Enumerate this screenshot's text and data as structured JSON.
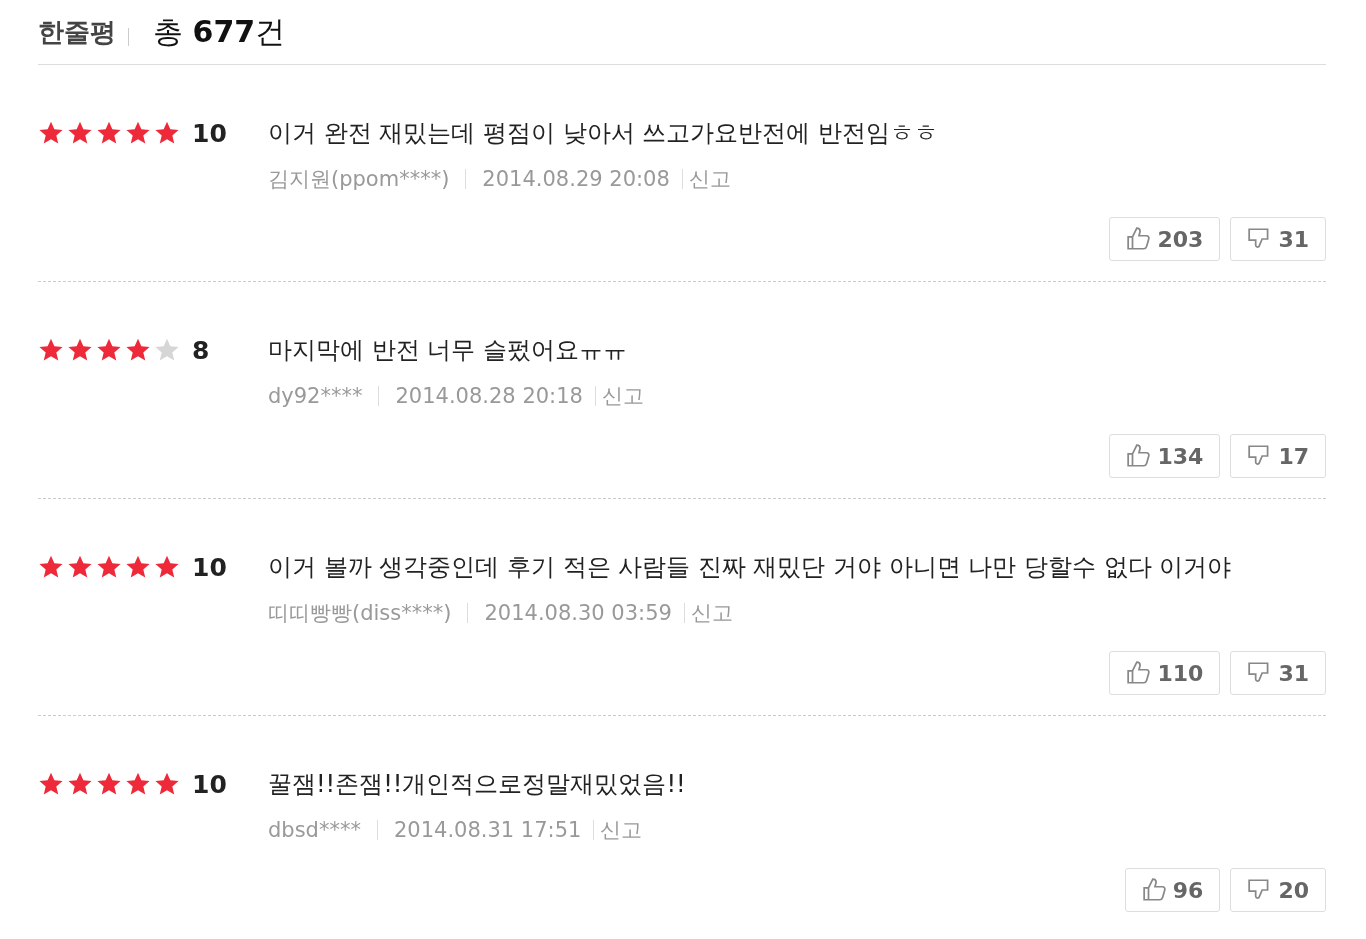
{
  "header": {
    "title": "한줄평",
    "total_prefix": "총",
    "total_count": "677",
    "total_suffix": "건"
  },
  "reviews": [
    {
      "stars": 5,
      "score": "10",
      "text": "이거 완전 재밌는데 평점이 낮아서 쓰고가요반전에 반전임ㅎㅎ",
      "author": "김지원(ppom****)",
      "date": "2014.08.29 20:08",
      "report": "신고",
      "likes": "203",
      "dislikes": "31"
    },
    {
      "stars": 4,
      "score": "8",
      "text": "마지막에 반전 너무 슬펐어요ㅠㅠ",
      "author": "dy92****",
      "date": "2014.08.28 20:18",
      "report": "신고",
      "likes": "134",
      "dislikes": "17"
    },
    {
      "stars": 5,
      "score": "10",
      "text": "이거 볼까 생각중인데 후기 적은 사람들 진짜 재밌단 거야 아니면 나만 당할수 없다 이거야",
      "author": "띠띠빵빵(diss****)",
      "date": "2014.08.30 03:59",
      "report": "신고",
      "likes": "110",
      "dislikes": "31"
    },
    {
      "stars": 5,
      "score": "10",
      "text": "꿀잼!!존잼!!개인적으로정말재밌었음!!",
      "author": "dbsd****",
      "date": "2014.08.31 17:51",
      "report": "신고",
      "likes": "96",
      "dislikes": "20"
    }
  ]
}
